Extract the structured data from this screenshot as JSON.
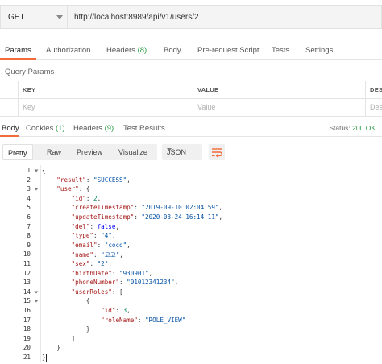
{
  "request": {
    "method": "GET",
    "url": "http://localhost:8989/api/v1/users/2"
  },
  "request_tabs": [
    {
      "label": "Params",
      "count": ""
    },
    {
      "label": "Authorization",
      "count": ""
    },
    {
      "label": "Headers",
      "count": "(8)"
    },
    {
      "label": "Body",
      "count": ""
    },
    {
      "label": "Pre-request Script",
      "count": ""
    },
    {
      "label": "Tests",
      "count": ""
    },
    {
      "label": "Settings",
      "count": ""
    }
  ],
  "query_params": {
    "title": "Query Params",
    "columns": [
      "KEY",
      "VALUE",
      "DESC"
    ],
    "placeholders": [
      "Key",
      "Value",
      "Des"
    ]
  },
  "response_tabs": [
    {
      "label": "Body",
      "count": ""
    },
    {
      "label": "Cookies",
      "count": "(1)"
    },
    {
      "label": "Headers",
      "count": "(9)"
    },
    {
      "label": "Test Results",
      "count": ""
    }
  ],
  "status": {
    "label": "Status:",
    "value": "200 OK"
  },
  "view_modes": [
    "Pretty",
    "Raw",
    "Preview",
    "Visualize"
  ],
  "format": "JSON",
  "colors": {
    "accent": "#f26b3a",
    "count": "#2e9b46"
  },
  "icons": [
    "dropdown-caret-icon",
    "wrap-lines-icon",
    "fold-arrow-icon"
  ],
  "code_lines": [
    [
      [
        "p",
        "{"
      ]
    ],
    [
      [
        "p",
        "    "
      ],
      [
        "k",
        "\"result\""
      ],
      [
        "p",
        ": "
      ],
      [
        "s",
        "\"SUCCESS\""
      ],
      [
        "p",
        ","
      ]
    ],
    [
      [
        "p",
        "    "
      ],
      [
        "k",
        "\"user\""
      ],
      [
        "p",
        ": {"
      ]
    ],
    [
      [
        "p",
        "        "
      ],
      [
        "k",
        "\"id\""
      ],
      [
        "p",
        ": "
      ],
      [
        "n",
        "2"
      ],
      [
        "p",
        ","
      ]
    ],
    [
      [
        "p",
        "        "
      ],
      [
        "k",
        "\"createTimestamp\""
      ],
      [
        "p",
        ": "
      ],
      [
        "s",
        "\"2019-09-10 02:04:59\""
      ],
      [
        "p",
        ","
      ]
    ],
    [
      [
        "p",
        "        "
      ],
      [
        "k",
        "\"updateTimestamp\""
      ],
      [
        "p",
        ": "
      ],
      [
        "s",
        "\"2020-03-24 16:14:11\""
      ],
      [
        "p",
        ","
      ]
    ],
    [
      [
        "p",
        "        "
      ],
      [
        "k",
        "\"del\""
      ],
      [
        "p",
        ": "
      ],
      [
        "b",
        "false"
      ],
      [
        "p",
        ","
      ]
    ],
    [
      [
        "p",
        "        "
      ],
      [
        "k",
        "\"type\""
      ],
      [
        "p",
        ": "
      ],
      [
        "s",
        "\"4\""
      ],
      [
        "p",
        ","
      ]
    ],
    [
      [
        "p",
        "        "
      ],
      [
        "k",
        "\"email\""
      ],
      [
        "p",
        ": "
      ],
      [
        "s",
        "\"coco\""
      ],
      [
        "p",
        ","
      ]
    ],
    [
      [
        "p",
        "        "
      ],
      [
        "k",
        "\"name\""
      ],
      [
        "p",
        ": "
      ],
      [
        "s",
        "\"코코\""
      ],
      [
        "p",
        ","
      ]
    ],
    [
      [
        "p",
        "        "
      ],
      [
        "k",
        "\"sex\""
      ],
      [
        "p",
        ": "
      ],
      [
        "s",
        "\"2\""
      ],
      [
        "p",
        ","
      ]
    ],
    [
      [
        "p",
        "        "
      ],
      [
        "k",
        "\"birthDate\""
      ],
      [
        "p",
        ": "
      ],
      [
        "s",
        "\"930901\""
      ],
      [
        "p",
        ","
      ]
    ],
    [
      [
        "p",
        "        "
      ],
      [
        "k",
        "\"phoneNumber\""
      ],
      [
        "p",
        ": "
      ],
      [
        "s",
        "\"01012341234\""
      ],
      [
        "p",
        ","
      ]
    ],
    [
      [
        "p",
        "        "
      ],
      [
        "k",
        "\"userRoles\""
      ],
      [
        "p",
        ": ["
      ]
    ],
    [
      [
        "p",
        "            {"
      ]
    ],
    [
      [
        "p",
        "                "
      ],
      [
        "k",
        "\"id\""
      ],
      [
        "p",
        ": "
      ],
      [
        "n",
        "3"
      ],
      [
        "p",
        ","
      ]
    ],
    [
      [
        "p",
        "                "
      ],
      [
        "k",
        "\"roleName\""
      ],
      [
        "p",
        ": "
      ],
      [
        "s",
        "\"ROLE_VIEW\""
      ]
    ],
    [
      [
        "p",
        "            }"
      ]
    ],
    [
      [
        "p",
        "        ]"
      ]
    ],
    [
      [
        "p",
        "    }"
      ]
    ],
    [
      [
        "p",
        "}"
      ]
    ]
  ]
}
